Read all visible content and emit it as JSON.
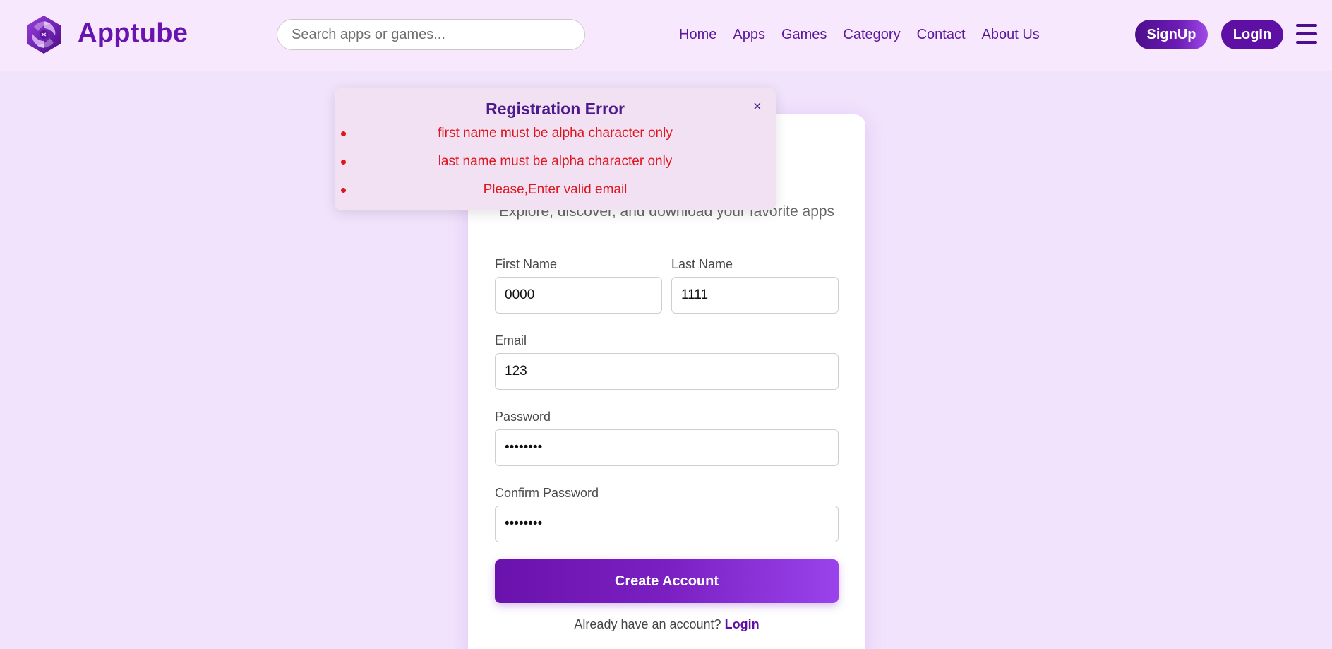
{
  "brand": {
    "name": "Apptube",
    "logo_icon": "apptube-logo-icon"
  },
  "search": {
    "placeholder": "Search apps or games..."
  },
  "nav": {
    "items": [
      "Home",
      "Apps",
      "Games",
      "Category",
      "Contact",
      "About Us"
    ]
  },
  "header_buttons": {
    "signup": "SignUp",
    "login": "LogIn"
  },
  "form": {
    "subtitle": "Explore, discover, and download your favorite apps",
    "first_name": {
      "label": "First Name",
      "value": "0000"
    },
    "last_name": {
      "label": "Last Name",
      "value": "1111"
    },
    "email": {
      "label": "Email",
      "value": "123"
    },
    "password": {
      "label": "Password",
      "value": "••••••••"
    },
    "confirm_password": {
      "label": "Confirm Password",
      "value": "••••••••"
    },
    "submit_label": "Create Account",
    "have_account_text": "Already have an account?",
    "login_link": "Login"
  },
  "error_popup": {
    "title": "Registration Error",
    "close": "×",
    "errors": [
      "first name must be alpha character only",
      "last name must be alpha character only",
      "Please,Enter valid email"
    ]
  },
  "colors": {
    "brand": "#6a14b0",
    "background": "#f2e3fc",
    "error": "#e0141c",
    "popup_bg": "#f1e1f3"
  }
}
